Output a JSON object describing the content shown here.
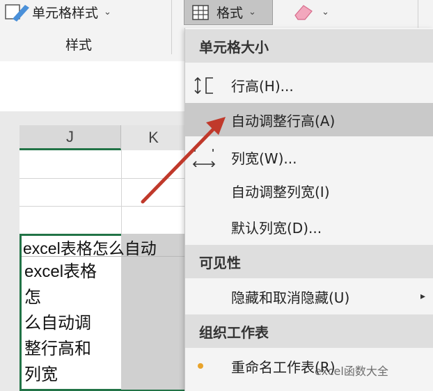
{
  "ribbon": {
    "cell_style_label": "单元格样式",
    "group_label": "样式",
    "format_label": "格式",
    "chevron": "⌄"
  },
  "sheet": {
    "columns": [
      "J",
      "K"
    ],
    "cell_text_wide": "excel表格怎么自动",
    "wrapped_lines": [
      "excel表格",
      "怎",
      "么自动调",
      "整行高和",
      "列宽"
    ]
  },
  "menu": {
    "sections": [
      {
        "header": "单元格大小"
      },
      {
        "header": "可见性"
      },
      {
        "header": "组织工作表"
      }
    ],
    "items": [
      {
        "label": "行高(H)...",
        "icon": "row-height-icon"
      },
      {
        "label": "自动调整行高(A)",
        "highlighted": true
      },
      {
        "label": "列宽(W)...",
        "icon": "column-width-icon"
      },
      {
        "label": "自动调整列宽(I)"
      },
      {
        "label": "默认列宽(D)..."
      },
      {
        "label": "隐藏和取消隐藏(U)",
        "submenu": "▸"
      },
      {
        "label": "重命名工作表(R)",
        "icon": "bullet-icon"
      }
    ]
  },
  "watermark": "excel函数大全",
  "colors": {
    "accent_green": "#217346",
    "arrow_red": "#c0392b",
    "menu_highlight": "#c9c9c9"
  }
}
